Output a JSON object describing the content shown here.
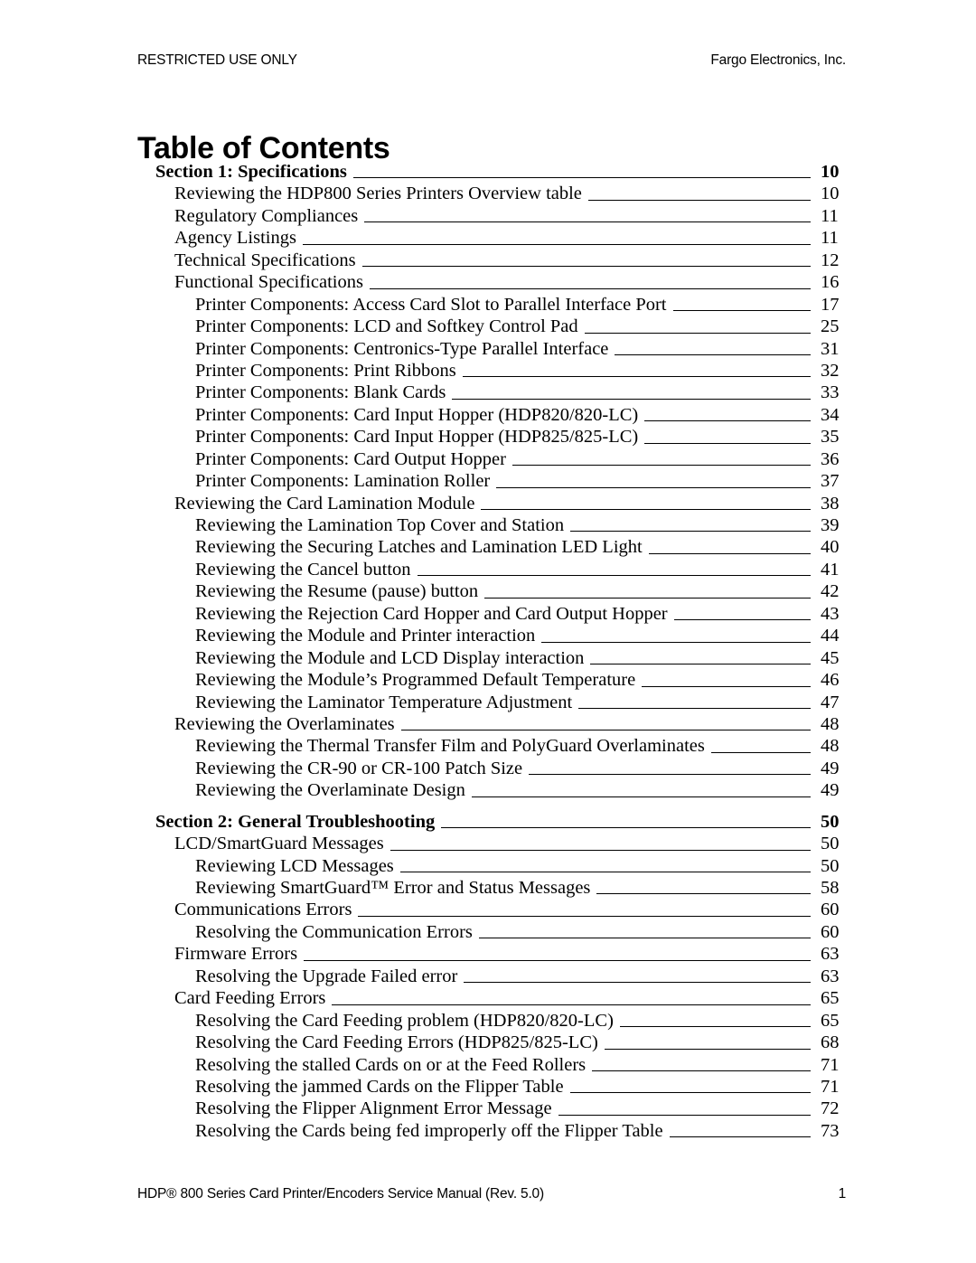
{
  "header": {
    "left": "RESTRICTED USE ONLY",
    "right": "Fargo Electronics, Inc."
  },
  "title": "Table of Contents",
  "footer": {
    "text": "HDP® 800 Series Card Printer/Encoders Service Manual (Rev. 5.0)",
    "page_number": "1"
  },
  "toc": {
    "entries": [
      {
        "level": 0,
        "label": "Section 1:  Specifications",
        "page": "10",
        "gap_before": false
      },
      {
        "level": 1,
        "label": "Reviewing the HDP800 Series Printers Overview table",
        "page": "10",
        "gap_before": false
      },
      {
        "level": 1,
        "label": "Regulatory Compliances",
        "page": "11",
        "gap_before": false
      },
      {
        "level": 1,
        "label": "Agency Listings",
        "page": "11",
        "gap_before": false
      },
      {
        "level": 1,
        "label": "Technical Specifications",
        "page": "12",
        "gap_before": false
      },
      {
        "level": 1,
        "label": "Functional Specifications",
        "page": "16",
        "gap_before": false
      },
      {
        "level": 2,
        "label": "Printer Components:  Access Card Slot to Parallel Interface Port",
        "page": "17",
        "gap_before": false
      },
      {
        "level": 2,
        "label": "Printer Components:  LCD and Softkey Control Pad",
        "page": "25",
        "gap_before": false
      },
      {
        "level": 2,
        "label": "Printer Components:  Centronics-Type Parallel Interface",
        "page": "31",
        "gap_before": false
      },
      {
        "level": 2,
        "label": "Printer Components:  Print Ribbons",
        "page": "32",
        "gap_before": false
      },
      {
        "level": 2,
        "label": "Printer Components:  Blank Cards",
        "page": "33",
        "gap_before": false
      },
      {
        "level": 2,
        "label": "Printer Components:  Card Input Hopper (HDP820/820-LC)",
        "page": "34",
        "gap_before": false
      },
      {
        "level": 2,
        "label": "Printer Components:  Card Input Hopper (HDP825/825-LC)",
        "page": "35",
        "gap_before": false
      },
      {
        "level": 2,
        "label": "Printer Components:  Card Output Hopper",
        "page": "36",
        "gap_before": false
      },
      {
        "level": 2,
        "label": "Printer Components:  Lamination Roller",
        "page": "37",
        "gap_before": false
      },
      {
        "level": 1,
        "label": "Reviewing the Card Lamination Module",
        "page": "38",
        "gap_before": false
      },
      {
        "level": 2,
        "label": "Reviewing the Lamination Top Cover and Station",
        "page": "39",
        "gap_before": false
      },
      {
        "level": 2,
        "label": "Reviewing the Securing Latches and Lamination LED Light",
        "page": "40",
        "gap_before": false
      },
      {
        "level": 2,
        "label": "Reviewing the Cancel button",
        "page": "41",
        "gap_before": false
      },
      {
        "level": 2,
        "label": "Reviewing the Resume (pause) button",
        "page": "42",
        "gap_before": false
      },
      {
        "level": 2,
        "label": "Reviewing the Rejection Card Hopper and Card Output Hopper",
        "page": "43",
        "gap_before": false
      },
      {
        "level": 2,
        "label": "Reviewing the Module and Printer interaction",
        "page": "44",
        "gap_before": false
      },
      {
        "level": 2,
        "label": "Reviewing the Module and LCD Display interaction",
        "page": "45",
        "gap_before": false
      },
      {
        "level": 2,
        "label": "Reviewing the Module’s Programmed Default Temperature",
        "page": "46",
        "gap_before": false
      },
      {
        "level": 2,
        "label": "Reviewing the Laminator Temperature Adjustment",
        "page": "47",
        "gap_before": false
      },
      {
        "level": 1,
        "label": "Reviewing the Overlaminates",
        "page": "48",
        "gap_before": false
      },
      {
        "level": 2,
        "label": "Reviewing the Thermal Transfer Film and PolyGuard Overlaminates",
        "page": "48",
        "gap_before": false
      },
      {
        "level": 2,
        "label": "Reviewing the CR-90 or CR-100 Patch Size",
        "page": "49",
        "gap_before": false
      },
      {
        "level": 2,
        "label": "Reviewing the Overlaminate Design",
        "page": "49",
        "gap_before": false
      },
      {
        "level": 0,
        "label": "Section 2:  General Troubleshooting",
        "page": "50",
        "gap_before": true
      },
      {
        "level": 1,
        "label": "LCD/SmartGuard Messages",
        "page": "50",
        "gap_before": false
      },
      {
        "level": 2,
        "label": "Reviewing LCD Messages",
        "page": "50",
        "gap_before": false
      },
      {
        "level": 2,
        "label": "Reviewing SmartGuard™ Error and Status Messages",
        "page": "58",
        "gap_before": false
      },
      {
        "level": 1,
        "label": "Communications Errors",
        "page": "60",
        "gap_before": false
      },
      {
        "level": 2,
        "label": "Resolving the Communication Errors",
        "page": "60",
        "gap_before": false
      },
      {
        "level": 1,
        "label": "Firmware Errors",
        "page": "63",
        "gap_before": false
      },
      {
        "level": 2,
        "label": "Resolving the Upgrade Failed error",
        "page": "63",
        "gap_before": false
      },
      {
        "level": 1,
        "label": "Card Feeding Errors",
        "page": "65",
        "gap_before": false
      },
      {
        "level": 2,
        "label": "Resolving the Card Feeding problem (HDP820/820-LC)",
        "page": "65",
        "gap_before": false
      },
      {
        "level": 2,
        "label": "Resolving the Card Feeding Errors (HDP825/825-LC)",
        "page": "68",
        "gap_before": false
      },
      {
        "level": 2,
        "label": "Resolving the stalled Cards on or at the Feed Rollers",
        "page": "71",
        "gap_before": false
      },
      {
        "level": 2,
        "label": "Resolving the jammed Cards on the Flipper Table",
        "page": "71",
        "gap_before": false
      },
      {
        "level": 2,
        "label": "Resolving the Flipper Alignment Error Message",
        "page": "72",
        "gap_before": false
      },
      {
        "level": 2,
        "label": "Resolving the Cards being fed improperly off the Flipper Table",
        "page": "73",
        "gap_before": false
      }
    ]
  }
}
